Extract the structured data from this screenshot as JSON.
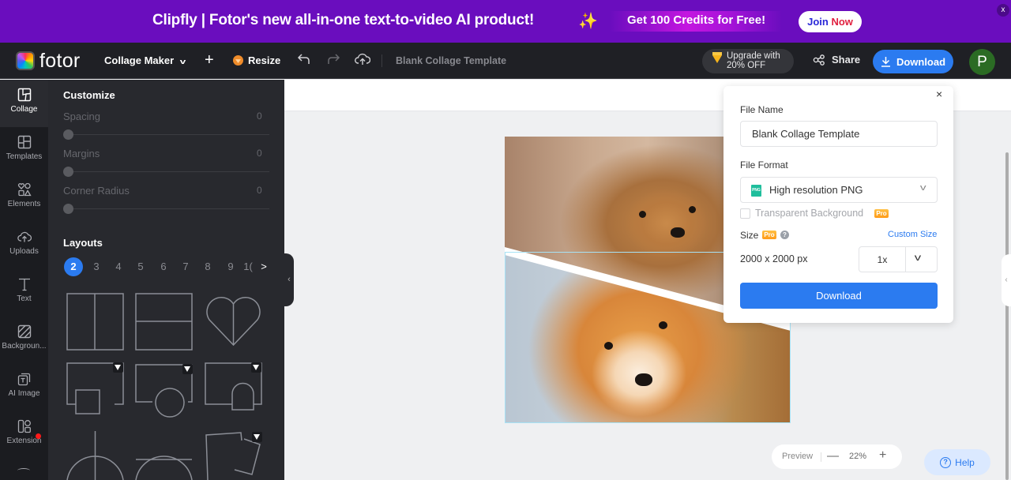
{
  "banner": {
    "promo_text": "Clipfly | Fotor's new all-in-one text-to-video AI product!",
    "sparkle_icon": "✨",
    "credits_prefix": "Get ",
    "credits_number": "100",
    "credits_suffix": " Credits for Free!",
    "join_part1": "Join ",
    "join_part2": "Now",
    "close_label": "x"
  },
  "topbar": {
    "logo_text": "fotor",
    "mode_label": "Collage Maker",
    "add_label": "+",
    "resize_label": "Resize",
    "document_title": "Blank Collage Template",
    "upgrade_line1": "Upgrade with",
    "upgrade_line2": "20% OFF",
    "share_label": "Share",
    "download_label": "Download",
    "avatar_initial": "P",
    "colors": {
      "accent": "#2b7bf0",
      "banner": "#6a0dbe",
      "avatar": "#2b6b24"
    }
  },
  "sidebar": {
    "items": [
      {
        "label": "Collage",
        "icon": "collage-icon",
        "active": true
      },
      {
        "label": "Templates",
        "icon": "templates-icon"
      },
      {
        "label": "Elements",
        "icon": "elements-icon"
      },
      {
        "label": "Uploads",
        "icon": "upload-cloud-icon"
      },
      {
        "label": "Text",
        "icon": "text-icon"
      },
      {
        "label": "Backgroun...",
        "icon": "background-icon"
      },
      {
        "label": "AI Image",
        "icon": "ai-image-icon"
      },
      {
        "label": "Extension",
        "icon": "extension-icon",
        "notification_dot": true
      }
    ]
  },
  "panel": {
    "customize_title": "Customize",
    "sliders": [
      {
        "label": "Spacing",
        "value": "0"
      },
      {
        "label": "Margins",
        "value": "0"
      },
      {
        "label": "Corner Radius",
        "value": "0"
      }
    ],
    "layouts_title": "Layouts",
    "layout_counts": [
      "2",
      "3",
      "4",
      "5",
      "6",
      "7",
      "8",
      "9",
      "1("
    ],
    "active_count": "2",
    "next_arrow": ">",
    "collapse_arrow": "‹",
    "layouts": [
      {
        "name": "two-vertical",
        "pro": false
      },
      {
        "name": "two-horizontal",
        "pro": false
      },
      {
        "name": "heart-split",
        "pro": false
      },
      {
        "name": "frame-with-square",
        "pro": true
      },
      {
        "name": "frame-with-circle",
        "pro": true
      },
      {
        "name": "frame-with-arch",
        "pro": true
      },
      {
        "name": "circle-vertical-split",
        "pro": false
      },
      {
        "name": "circle-horizontal-split",
        "pro": false
      },
      {
        "name": "tilted-frames",
        "pro": true
      }
    ]
  },
  "download_panel": {
    "close_label": "×",
    "file_name_label": "File Name",
    "file_name_value": "Blank Collage Template",
    "file_format_label": "File Format",
    "file_format_value": "High resolution PNG",
    "png_badge": "PNG",
    "transparent_label": "Transparent Background",
    "transparent_checked": false,
    "pro_badge": "Pro",
    "size_label": "Size",
    "help_glyph": "?",
    "custom_size_link": "Custom Size",
    "size_value": "2000 x 2000 px",
    "scale_value": "1x",
    "download_button": "Download"
  },
  "canvas": {
    "images": [
      "pomeranian-photo",
      "shiba-inu-photo"
    ]
  },
  "footer": {
    "preview_label": "Preview",
    "zoom_minus": "—",
    "zoom_value": "22%",
    "zoom_plus": "+",
    "help_label": "Help",
    "help_glyph": "?",
    "right_tab_arrow": "‹"
  }
}
